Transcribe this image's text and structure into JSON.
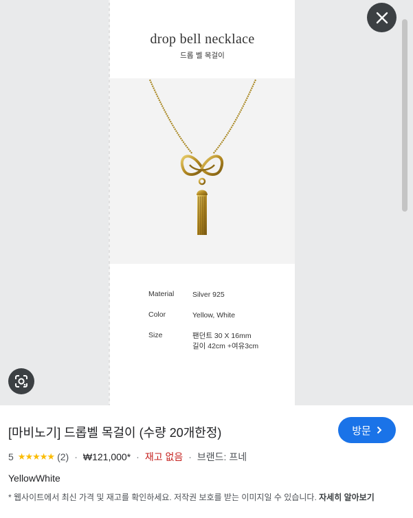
{
  "image": {
    "title": "drop bell necklace",
    "subtitle": "드롭 벨 목걸이",
    "specs": [
      {
        "label": "Material",
        "value": "Silver 925"
      },
      {
        "label": "Color",
        "value": "Yellow, White"
      },
      {
        "label": "Size",
        "value": "팬던트 30 X 16mm\n길이 42cm +여유3cm"
      }
    ]
  },
  "controls": {
    "close_icon": "close-icon",
    "lens_icon": "lens-search-icon"
  },
  "product": {
    "title": "[마비노기] 드롭벨 목걸이 (수량 20개한정)",
    "visit_label": "방문",
    "rating": "5",
    "stars": "★★★★★",
    "review_count": "(2)",
    "price": "₩121,000*",
    "stock": "재고 없음",
    "brand": "브랜드: 프네",
    "variant": "YellowWhite",
    "disclaimer": "* 웹사이트에서 최신 가격 및 재고를 확인하세요. 저작권 보호를 받는 이미지일 수 있습니다.",
    "learn_more": "자세히 알아보기"
  },
  "colors": {
    "accent": "#1a73e8",
    "star": "#fbbc04",
    "out_of_stock": "#c5221f",
    "necklace_gold": "#b8952a"
  }
}
